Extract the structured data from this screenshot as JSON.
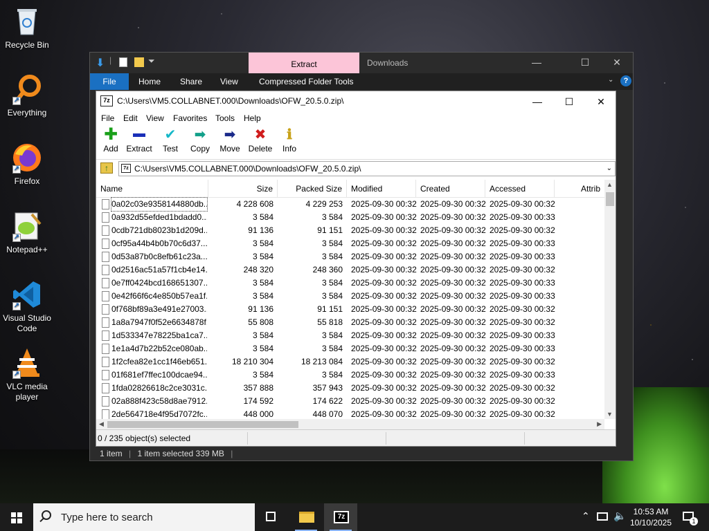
{
  "desktop": {
    "icons": [
      {
        "label": "Recycle Bin",
        "icon": "recycle-bin-icon"
      },
      {
        "label": "Everything",
        "icon": "everything-icon"
      },
      {
        "label": "Firefox",
        "icon": "firefox-icon"
      },
      {
        "label": "Notepad++",
        "icon": "notepad-plus-plus-icon"
      },
      {
        "label": "Visual Studio Code",
        "icon": "vscode-icon"
      },
      {
        "label": "VLC media player",
        "icon": "vlc-icon"
      }
    ]
  },
  "explorer": {
    "tab_label": "Extract",
    "title": "Downloads",
    "ribbon": [
      "File",
      "Home",
      "Share",
      "View",
      "Compressed Folder Tools"
    ],
    "status_items": "1 item",
    "status_selected": "1 item selected  339 MB"
  },
  "sevenzip": {
    "title": "C:\\Users\\VM5.COLLABNET.000\\Downloads\\OFW_20.5.0.zip\\",
    "logo": "7z",
    "menu": [
      "File",
      "Edit",
      "View",
      "Favorites",
      "Tools",
      "Help"
    ],
    "toolbar": [
      {
        "label": "Add",
        "icon": "add-icon",
        "glyph": "+",
        "color": "#1aa01a"
      },
      {
        "label": "Extract",
        "icon": "extract-icon",
        "glyph": "—",
        "color": "#1a2fb8"
      },
      {
        "label": "Test",
        "icon": "test-icon",
        "glyph": "✓",
        "color": "#16b8c8"
      },
      {
        "label": "Copy",
        "icon": "copy-icon",
        "glyph": "➡",
        "color": "#13a08a"
      },
      {
        "label": "Move",
        "icon": "move-icon",
        "glyph": "➡",
        "color": "#1a2a8a"
      },
      {
        "label": "Delete",
        "icon": "delete-icon",
        "glyph": "✖",
        "color": "#d01c1c"
      },
      {
        "label": "Info",
        "icon": "info-icon",
        "glyph": "i",
        "color": "#c8a21a"
      }
    ],
    "address": "C:\\Users\\VM5.COLLABNET.000\\Downloads\\OFW_20.5.0.zip\\",
    "columns": [
      "Name",
      "Size",
      "Packed Size",
      "Modified",
      "Created",
      "Accessed",
      "Attrib"
    ],
    "rows": [
      [
        "0a02c03e9358144880db...",
        "4 228 608",
        "4 229 253",
        "2025-09-30 00:32",
        "2025-09-30 00:32",
        "2025-09-30 00:32"
      ],
      [
        "0a932d55efded1bdadd0...",
        "3 584",
        "3 584",
        "2025-09-30 00:32",
        "2025-09-30 00:32",
        "2025-09-30 00:33"
      ],
      [
        "0cdb721db8023b1d209d...",
        "91 136",
        "91 151",
        "2025-09-30 00:32",
        "2025-09-30 00:32",
        "2025-09-30 00:32"
      ],
      [
        "0cf95a44b4b0b70c6d37...",
        "3 584",
        "3 584",
        "2025-09-30 00:32",
        "2025-09-30 00:32",
        "2025-09-30 00:33"
      ],
      [
        "0d53a87b0c8efb61c23a...",
        "3 584",
        "3 584",
        "2025-09-30 00:32",
        "2025-09-30 00:32",
        "2025-09-30 00:33"
      ],
      [
        "0d2516ac51a57f1cb4e14...",
        "248 320",
        "248 360",
        "2025-09-30 00:32",
        "2025-09-30 00:32",
        "2025-09-30 00:32"
      ],
      [
        "0e7ff0424bcd168651307...",
        "3 584",
        "3 584",
        "2025-09-30 00:32",
        "2025-09-30 00:32",
        "2025-09-30 00:33"
      ],
      [
        "0e42f66f6c4e850b57ea1f...",
        "3 584",
        "3 584",
        "2025-09-30 00:32",
        "2025-09-30 00:32",
        "2025-09-30 00:33"
      ],
      [
        "0f768bf89a3e491e27003...",
        "91 136",
        "91 151",
        "2025-09-30 00:32",
        "2025-09-30 00:32",
        "2025-09-30 00:32"
      ],
      [
        "1a8a7947f0f52e6634878f...",
        "55 808",
        "55 818",
        "2025-09-30 00:32",
        "2025-09-30 00:32",
        "2025-09-30 00:32"
      ],
      [
        "1d533347e78225ba1ca7...",
        "3 584",
        "3 584",
        "2025-09-30 00:32",
        "2025-09-30 00:32",
        "2025-09-30 00:33"
      ],
      [
        "1e1a4d7b22b52ce080ab...",
        "3 584",
        "3 584",
        "2025-09-30 00:32",
        "2025-09-30 00:32",
        "2025-09-30 00:33"
      ],
      [
        "1f2cfea82e1cc1f46eb651...",
        "18 210 304",
        "18 213 084",
        "2025-09-30 00:32",
        "2025-09-30 00:32",
        "2025-09-30 00:32"
      ],
      [
        "01f681ef7ffec100dcae94...",
        "3 584",
        "3 584",
        "2025-09-30 00:32",
        "2025-09-30 00:32",
        "2025-09-30 00:33"
      ],
      [
        "1fda02826618c2ce3031c...",
        "357 888",
        "357 943",
        "2025-09-30 00:32",
        "2025-09-30 00:32",
        "2025-09-30 00:32"
      ],
      [
        "02a888f423c58d8ae7912...",
        "174 592",
        "174 622",
        "2025-09-30 00:32",
        "2025-09-30 00:32",
        "2025-09-30 00:32"
      ],
      [
        "2de564718e4f95d7072fc...",
        "448 000",
        "448 070",
        "2025-09-30 00:32",
        "2025-09-30 00:32",
        "2025-09-30 00:32"
      ]
    ],
    "status": "0 / 235 object(s) selected"
  },
  "taskbar": {
    "search_placeholder": "Type here to search",
    "time": "10:53 AM",
    "date": "10/10/2025",
    "notification_count": "1"
  }
}
